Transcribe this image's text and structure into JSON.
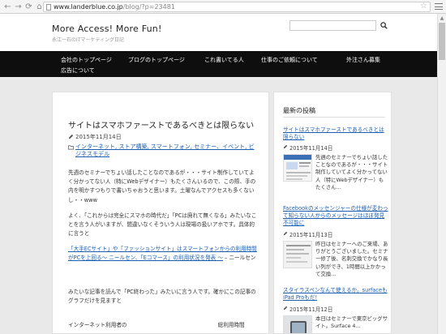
{
  "browser": {
    "url_host": "www.landerblue.co.jp",
    "url_path": "/blog/?p=23481"
  },
  "site": {
    "title": "More Access! More Fun!",
    "description": "永江一石のITマーケティング日記"
  },
  "nav": {
    "items": [
      "会社のトップページ",
      "ブログのトップページ",
      "これ書いてる人",
      "仕事のご依頼について",
      "外注さん募集",
      "広告について"
    ]
  },
  "post": {
    "title": "サイトはスマホファーストであるべきとは限らない",
    "date": "2015年11月14日",
    "categories": "インターネット, ストア構築, スマートフォン, セミナー、イベント, ビジネスモデル",
    "para1": "先週のセミナーでちょい話したことなのであるが・・・サイト制作していてよく分かってない人（特にWebデザイナー）もたくさんいるので、この際、手の内を明かすつもりで書いちゃおうと思います。土曜なんでアクセスも多くないし・・www",
    "para2": "よく、「これからは完全にスマホの時代だ」「PCは廃れて無くなる」みたいなことを言う人がいますが、間違いなくそういう人は現場の扱いアホです。具体的に言うと",
    "para3_link": "「大手ECサイト」や「ファッションサイト」はスマートフォンからの利用時間がPCを上回る～ ニールセン、「Eコマース」の利用状況を発表 ～",
    "para3_tail": " – ニールセン",
    "para4": "みたいな記事を読んで「PC終わった」みたいに言う人です。確かにこの記事のグラフだけを見ますと",
    "para5": "インターネット利用者の　　　　　　　　　　　　　　　　　総利用時間"
  },
  "sidebar": {
    "heading": "最新の投稿",
    "posts": [
      {
        "title": "サイトはスマホファーストであるべきとは限らない",
        "date": "2015年11月14日",
        "excerpt": "先週のセミナーでちょい話したことなのであるが・・・サイト制作していてよく分かってない人（特にWebデザイナー）もたくさん…"
      },
      {
        "title": "Facebookのメッセンジャーの仕様が変わって知らない人からのメッセージはほぼ発見不可能に",
        "date": "2015年11月13日",
        "excerpt": "昨日はセミナーへのご来場、ありがとうございました。セミナー修了後、名刺交換でかなり長い列ができ、1時間以上かかって交換…"
      },
      {
        "title": "スタイラスペンなんて使えるか。surfaceもiPad Proもだ!",
        "date": "2015年11月12日",
        "excerpt": "本日はセミナーで東京ビッグサイト。Surface 4…"
      }
    ]
  },
  "colors": {
    "navbar_bg": "#0e0e0e",
    "link": "#1a5fb4",
    "page_bg": "#e9e9e9"
  }
}
